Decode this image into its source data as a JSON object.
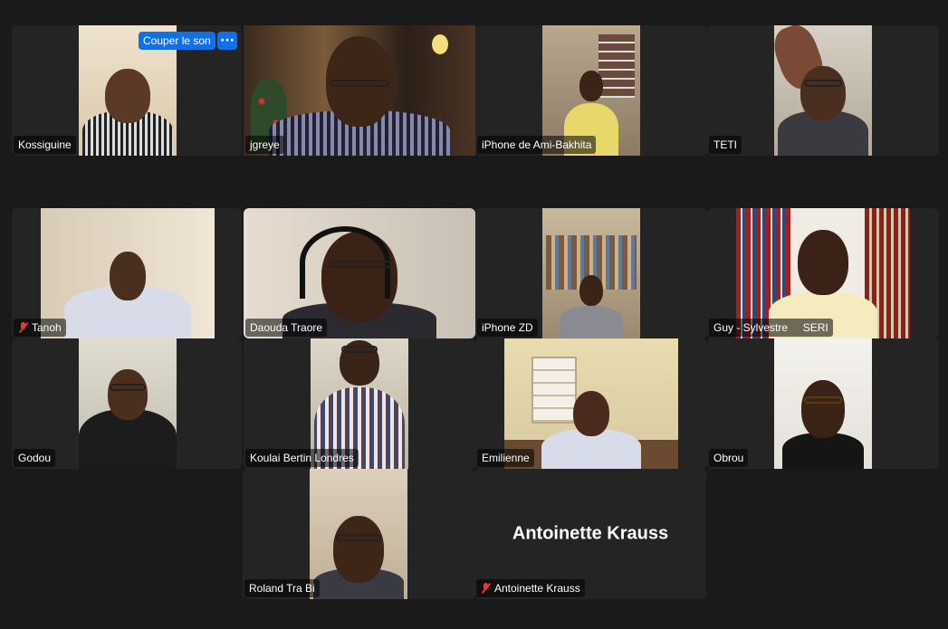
{
  "controls": {
    "unmute_label": "Couper le son",
    "more_label": "···"
  },
  "participants": [
    {
      "name": "Kossiguine",
      "muted": false,
      "active_speaker": false
    },
    {
      "name": "jgreye",
      "muted": false,
      "active_speaker": true
    },
    {
      "name": "iPhone de Ami-Bakhita",
      "muted": false,
      "active_speaker": false
    },
    {
      "name": "TETI",
      "muted": false,
      "active_speaker": false
    },
    {
      "name": "Tanoh",
      "muted": true,
      "active_speaker": false
    },
    {
      "name": "Daouda Traore",
      "muted": false,
      "active_speaker": false
    },
    {
      "name": "iPhone ZD",
      "muted": false,
      "active_speaker": false
    },
    {
      "name": "Guy - Sylvestre     SERI",
      "muted": false,
      "active_speaker": false
    },
    {
      "name": "Godou",
      "muted": false,
      "active_speaker": false
    },
    {
      "name": "Koulai Bertin Londres",
      "muted": false,
      "active_speaker": false
    },
    {
      "name": "Emilienne",
      "muted": false,
      "active_speaker": false
    },
    {
      "name": "Obrou",
      "muted": false,
      "active_speaker": false
    },
    {
      "name": "Roland Tra Bi",
      "muted": false,
      "active_speaker": false
    },
    {
      "name": "Antoinette Krauss",
      "muted": true,
      "active_speaker": false,
      "video_off": true
    }
  ],
  "colors": {
    "background": "#1a1a1a",
    "tile": "#242424",
    "active_border": "#23d959",
    "button": "#0e71eb",
    "muted": "#e53935"
  }
}
